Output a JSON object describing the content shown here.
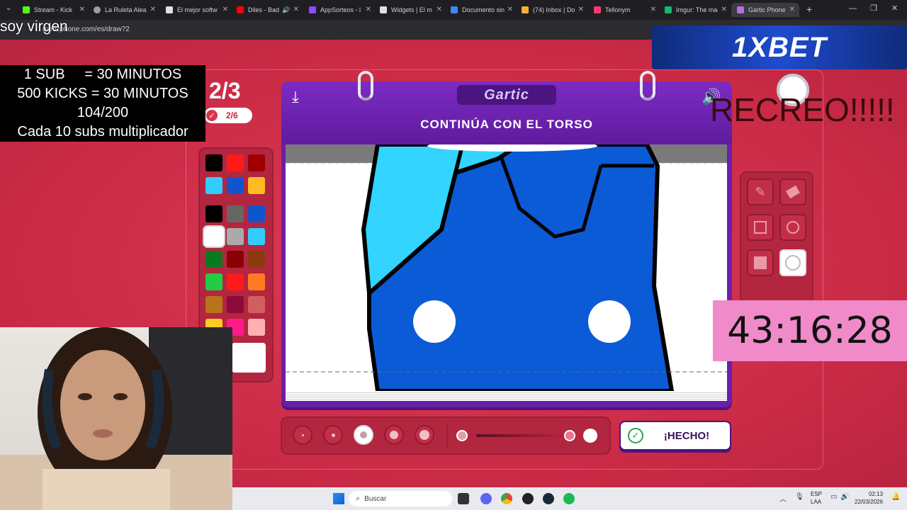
{
  "browser": {
    "tabs": [
      {
        "label": "Stream - Kick",
        "color": "#53fc18"
      },
      {
        "label": "La Ruleta Alea",
        "color": "#9aa0a6"
      },
      {
        "label": "El mejor softw",
        "color": "#e0e0e0"
      },
      {
        "label": "Diles - Bad",
        "color": "#ff0000"
      },
      {
        "label": "AppSorteos - l",
        "color": "#9147ff"
      },
      {
        "label": "Widgets | El m",
        "color": "#e0e0e0"
      },
      {
        "label": "Documento sin",
        "color": "#4285f4"
      },
      {
        "label": "(74) Inbox | Do",
        "color": "#f2b134"
      },
      {
        "label": "Tellonym",
        "color": "#ff3a6e"
      },
      {
        "label": "Imgur: The ma",
        "color": "#1bb76e"
      },
      {
        "label": "Gartic Phone",
        "color": "#b66ee8"
      }
    ],
    "url": "garticphone.com/es/draw?2"
  },
  "overlay": {
    "title": "soy virgen",
    "rules": [
      "1 SUB     = 30 MINUTOS",
      "500 KICKS = 30 MINUTOS",
      "104/200",
      "Cada 10 subs multiplicador"
    ],
    "ad": "1XBET",
    "recreo": "RECREO!!!!!",
    "timer": "43:16:28"
  },
  "game": {
    "round": "2/3",
    "players_done": "2/6",
    "logo": "Gartic",
    "instruction": "CONTINÚA CON EL TORSO",
    "done_label": "¡HECHO!",
    "palette": {
      "top": [
        "#000000",
        "#ff1a1a",
        "#a00000",
        "#33ccff",
        "#1155cc",
        "#ffbb22"
      ],
      "grid": [
        "#000000",
        "#666666",
        "#1155cc",
        "#ffffff",
        "#aaaaaa",
        "#33ccff",
        "#0b7a1f",
        "#8b0000",
        "#8b3a10",
        "#22cc44",
        "#ff1a1a",
        "#ff7a22",
        "#b8741a",
        "#8b0a3a",
        "#d06060",
        "#ffcc22",
        "#ff1a8a",
        "#ffb0b0"
      ],
      "selected": "#ffffff"
    },
    "tools": [
      "pencil-icon",
      "eraser-icon",
      "rectangle-icon",
      "ellipse-icon",
      "filled-rectangle-icon",
      "filled-ellipse-icon"
    ],
    "brush_sizes": [
      1,
      2,
      3,
      4,
      5
    ],
    "selected_brush": 3
  },
  "taskbar": {
    "search_placeholder": "Buscar",
    "lang_line1": "ESP",
    "lang_line2": "LAA",
    "time": "02:13",
    "date": "22/03/2026"
  }
}
